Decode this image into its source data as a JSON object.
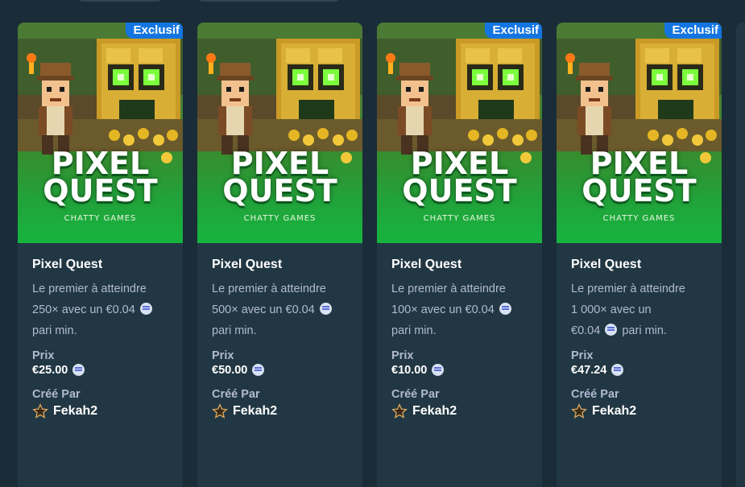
{
  "cards": [
    {
      "badge": "Exclusif",
      "image_title_line1": "PIXEL",
      "image_title_line2": "QUEST",
      "image_studio": "CHATTY GAMES",
      "name": "Pixel Quest",
      "desc_line1": "Le premier à atteindre",
      "desc_line2": "250× avec un €0.04",
      "desc_line3": "pari min.",
      "price_label": "Prix",
      "price": "€25.00",
      "creator_label": "Créé Par",
      "creator": "Fekah2"
    },
    {
      "badge": "",
      "image_title_line1": "PIXEL",
      "image_title_line2": "QUEST",
      "image_studio": "CHATTY GAMES",
      "name": "Pixel Quest",
      "desc_line1": "Le premier à atteindre",
      "desc_line2": "500× avec un €0.04",
      "desc_line3": "pari min.",
      "price_label": "Prix",
      "price": "€50.00",
      "creator_label": "Créé Par",
      "creator": "Fekah2"
    },
    {
      "badge": "Exclusif",
      "image_title_line1": "PIXEL",
      "image_title_line2": "QUEST",
      "image_studio": "CHATTY GAMES",
      "name": "Pixel Quest",
      "desc_line1": "Le premier à atteindre",
      "desc_line2": "100× avec un €0.04",
      "desc_line3": "pari min.",
      "price_label": "Prix",
      "price": "€10.00",
      "creator_label": "Créé Par",
      "creator": "Fekah2"
    },
    {
      "badge": "Exclusif",
      "image_title_line1": "PIXEL",
      "image_title_line2": "QUEST",
      "image_studio": "CHATTY GAMES",
      "name": "Pixel Quest",
      "desc_line1": "Le premier à atteindre",
      "desc_line2": "1 000× avec un",
      "desc_line3": "€0.04",
      "desc_line3b": "pari min.",
      "price_label": "Prix",
      "price": "€47.24",
      "creator_label": "Créé Par",
      "creator": "Fekah2"
    }
  ],
  "icons": {
    "currency": "coin-icon",
    "rank": "star-icon"
  },
  "colors": {
    "badge": "#1475e1",
    "card": "#213743",
    "background": "#1a2c38",
    "muted_text": "#b1bad3"
  }
}
